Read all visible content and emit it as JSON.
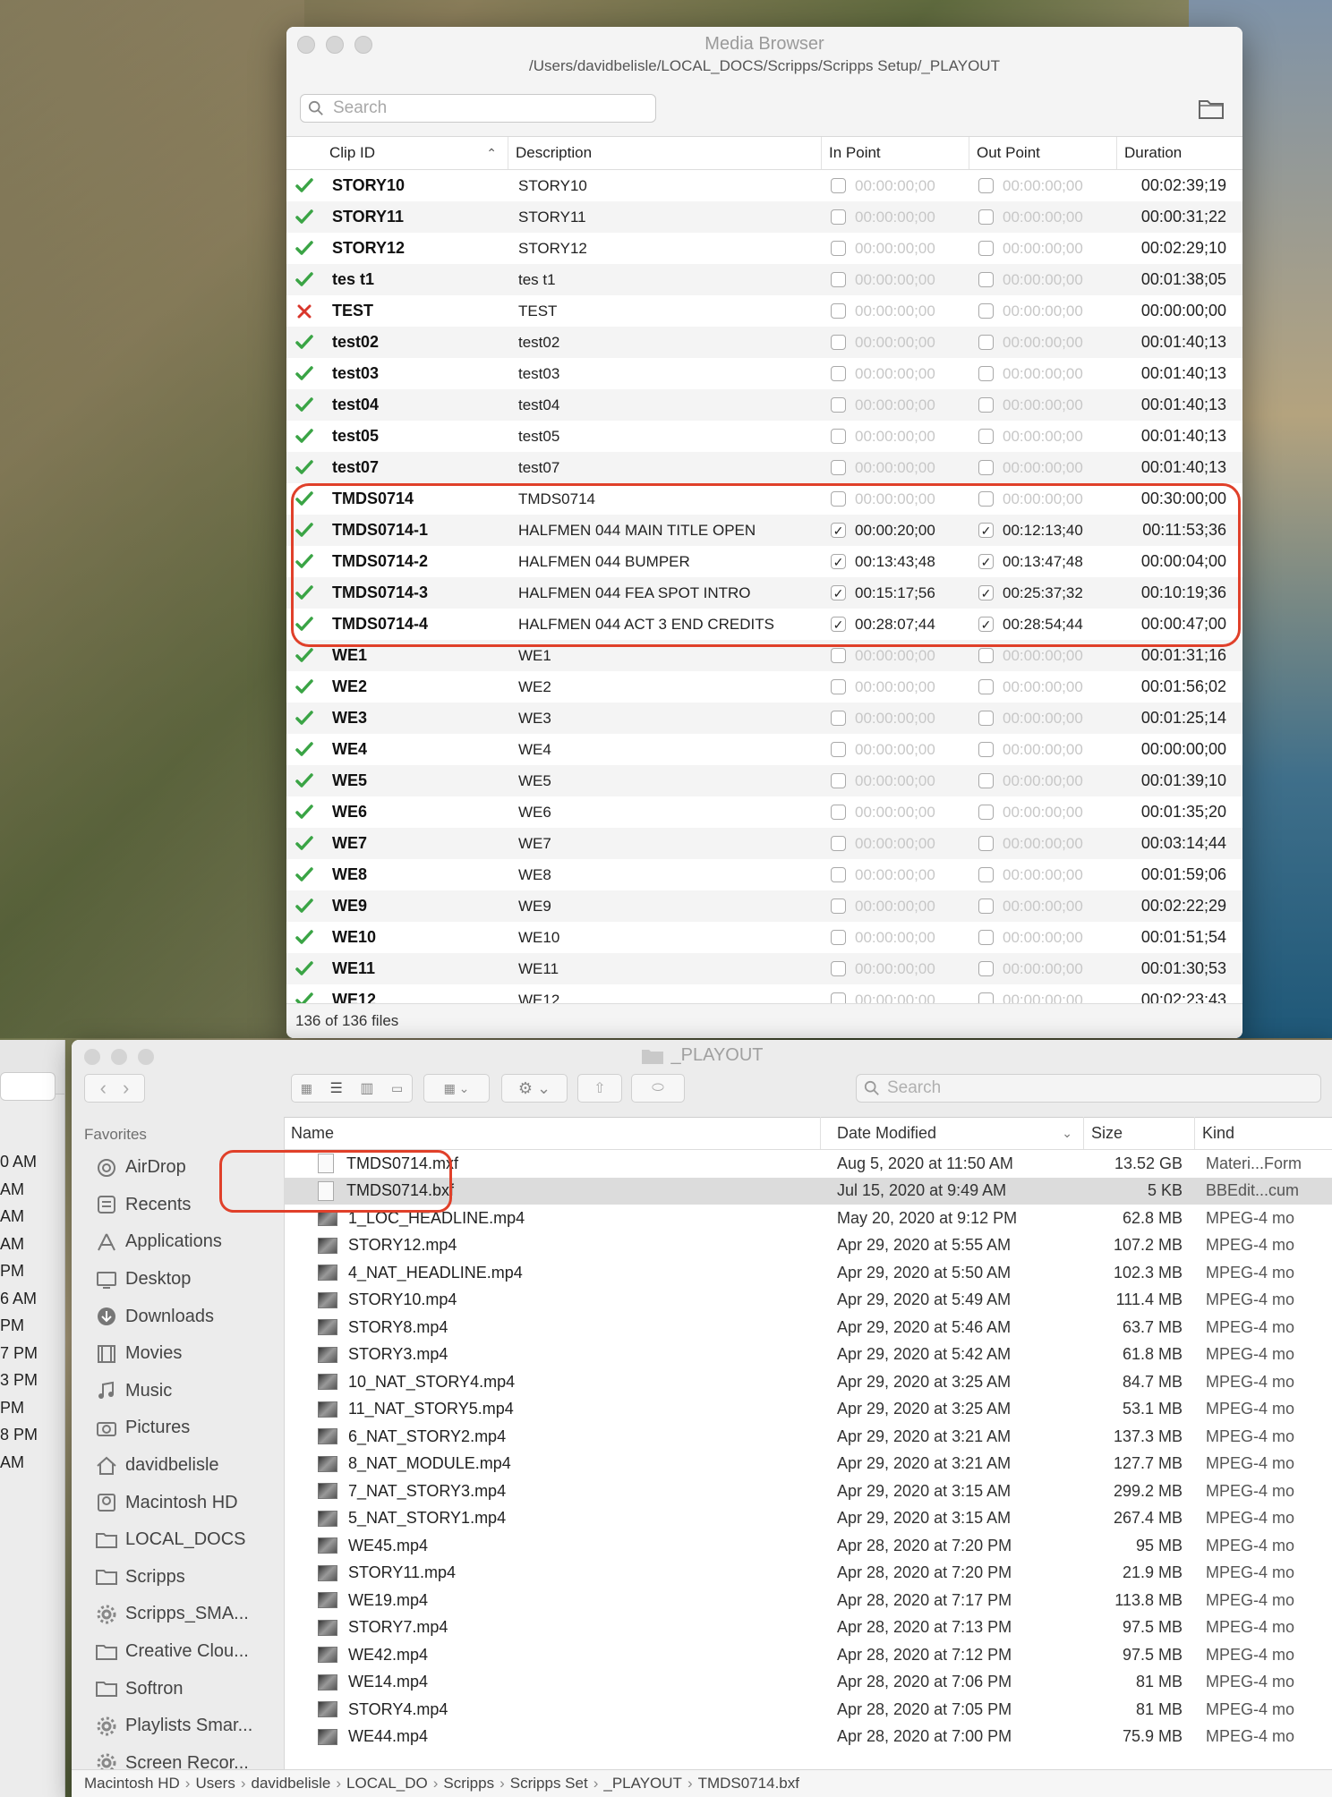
{
  "media_browser": {
    "title": "Media Browser",
    "path": "/Users/davidbelisle/LOCAL_DOCS/Scripps/Scripps Setup/_PLAYOUT",
    "search_placeholder": "Search",
    "columns": {
      "clip_id": "Clip ID",
      "description": "Description",
      "in_point": "In Point",
      "out_point": "Out Point",
      "duration": "Duration"
    },
    "rows": [
      {
        "status": "ok",
        "clip": "STORY10",
        "desc": "STORY10",
        "in_checked": false,
        "in": "00:00:00;00",
        "out_checked": false,
        "out": "00:00:00;00",
        "dur": "00:02:39;19"
      },
      {
        "status": "ok",
        "clip": "STORY11",
        "desc": "STORY11",
        "in_checked": false,
        "in": "00:00:00;00",
        "out_checked": false,
        "out": "00:00:00;00",
        "dur": "00:00:31;22"
      },
      {
        "status": "ok",
        "clip": "STORY12",
        "desc": "STORY12",
        "in_checked": false,
        "in": "00:00:00;00",
        "out_checked": false,
        "out": "00:00:00;00",
        "dur": "00:02:29;10"
      },
      {
        "status": "ok",
        "clip": "tes t1",
        "desc": "tes t1",
        "in_checked": false,
        "in": "00:00:00;00",
        "out_checked": false,
        "out": "00:00:00;00",
        "dur": "00:01:38;05"
      },
      {
        "status": "error",
        "clip": "TEST",
        "desc": "TEST",
        "in_checked": false,
        "in": "00:00:00;00",
        "out_checked": false,
        "out": "00:00:00;00",
        "dur": "00:00:00;00"
      },
      {
        "status": "ok",
        "clip": "test02",
        "desc": "test02",
        "in_checked": false,
        "in": "00:00:00;00",
        "out_checked": false,
        "out": "00:00:00;00",
        "dur": "00:01:40;13"
      },
      {
        "status": "ok",
        "clip": "test03",
        "desc": "test03",
        "in_checked": false,
        "in": "00:00:00;00",
        "out_checked": false,
        "out": "00:00:00;00",
        "dur": "00:01:40;13"
      },
      {
        "status": "ok",
        "clip": "test04",
        "desc": "test04",
        "in_checked": false,
        "in": "00:00:00;00",
        "out_checked": false,
        "out": "00:00:00;00",
        "dur": "00:01:40;13"
      },
      {
        "status": "ok",
        "clip": "test05",
        "desc": "test05",
        "in_checked": false,
        "in": "00:00:00;00",
        "out_checked": false,
        "out": "00:00:00;00",
        "dur": "00:01:40;13"
      },
      {
        "status": "ok",
        "clip": "test07",
        "desc": "test07",
        "in_checked": false,
        "in": "00:00:00;00",
        "out_checked": false,
        "out": "00:00:00;00",
        "dur": "00:01:40;13"
      },
      {
        "status": "ok",
        "clip": "TMDS0714",
        "desc": "TMDS0714",
        "in_checked": false,
        "in": "00:00:00;00",
        "out_checked": false,
        "out": "00:00:00;00",
        "dur": "00:30:00;00"
      },
      {
        "status": "ok",
        "clip": "TMDS0714-1",
        "desc": "HALFMEN 044 MAIN TITLE OPEN",
        "in_checked": true,
        "in": "00:00:20;00",
        "out_checked": true,
        "out": "00:12:13;40",
        "dur": "00:11:53;36"
      },
      {
        "status": "ok",
        "clip": "TMDS0714-2",
        "desc": "HALFMEN 044 BUMPER",
        "in_checked": true,
        "in": "00:13:43;48",
        "out_checked": true,
        "out": "00:13:47;48",
        "dur": "00:00:04;00"
      },
      {
        "status": "ok",
        "clip": "TMDS0714-3",
        "desc": "HALFMEN 044 FEA SPOT INTRO",
        "in_checked": true,
        "in": "00:15:17;56",
        "out_checked": true,
        "out": "00:25:37;32",
        "dur": "00:10:19;36"
      },
      {
        "status": "ok",
        "clip": "TMDS0714-4",
        "desc": "HALFMEN 044 ACT 3 END CREDITS",
        "in_checked": true,
        "in": "00:28:07;44",
        "out_checked": true,
        "out": "00:28:54;44",
        "dur": "00:00:47;00"
      },
      {
        "status": "ok",
        "clip": "WE1",
        "desc": "WE1",
        "in_checked": false,
        "in": "00:00:00;00",
        "out_checked": false,
        "out": "00:00:00;00",
        "dur": "00:01:31;16"
      },
      {
        "status": "ok",
        "clip": "WE2",
        "desc": "WE2",
        "in_checked": false,
        "in": "00:00:00;00",
        "out_checked": false,
        "out": "00:00:00;00",
        "dur": "00:01:56;02"
      },
      {
        "status": "ok",
        "clip": "WE3",
        "desc": "WE3",
        "in_checked": false,
        "in": "00:00:00;00",
        "out_checked": false,
        "out": "00:00:00;00",
        "dur": "00:01:25;14"
      },
      {
        "status": "ok",
        "clip": "WE4",
        "desc": "WE4",
        "in_checked": false,
        "in": "00:00:00;00",
        "out_checked": false,
        "out": "00:00:00;00",
        "dur": "00:00:00;00"
      },
      {
        "status": "ok",
        "clip": "WE5",
        "desc": "WE5",
        "in_checked": false,
        "in": "00:00:00;00",
        "out_checked": false,
        "out": "00:00:00;00",
        "dur": "00:01:39;10"
      },
      {
        "status": "ok",
        "clip": "WE6",
        "desc": "WE6",
        "in_checked": false,
        "in": "00:00:00;00",
        "out_checked": false,
        "out": "00:00:00;00",
        "dur": "00:01:35;20"
      },
      {
        "status": "ok",
        "clip": "WE7",
        "desc": "WE7",
        "in_checked": false,
        "in": "00:00:00;00",
        "out_checked": false,
        "out": "00:00:00;00",
        "dur": "00:03:14;44"
      },
      {
        "status": "ok",
        "clip": "WE8",
        "desc": "WE8",
        "in_checked": false,
        "in": "00:00:00;00",
        "out_checked": false,
        "out": "00:00:00;00",
        "dur": "00:01:59;06"
      },
      {
        "status": "ok",
        "clip": "WE9",
        "desc": "WE9",
        "in_checked": false,
        "in": "00:00:00;00",
        "out_checked": false,
        "out": "00:00:00;00",
        "dur": "00:02:22;29"
      },
      {
        "status": "ok",
        "clip": "WE10",
        "desc": "WE10",
        "in_checked": false,
        "in": "00:00:00;00",
        "out_checked": false,
        "out": "00:00:00;00",
        "dur": "00:01:51;54"
      },
      {
        "status": "ok",
        "clip": "WE11",
        "desc": "WE11",
        "in_checked": false,
        "in": "00:00:00;00",
        "out_checked": false,
        "out": "00:00:00;00",
        "dur": "00:01:30;53"
      },
      {
        "status": "ok",
        "clip": "WE12",
        "desc": "WE12",
        "in_checked": false,
        "in": "00:00:00;00",
        "out_checked": false,
        "out": "00:00:00;00",
        "dur": "00:02:23;43"
      }
    ],
    "footer": "136 of 136 files"
  },
  "left_window_times": [
    "0 AM",
    " AM",
    " AM",
    " AM",
    "PM",
    "6 AM",
    " PM",
    "7 PM",
    "3 PM",
    " PM",
    "8 PM",
    "AM"
  ],
  "finder": {
    "title": "_PLAYOUT",
    "search_placeholder": "Search",
    "favorites_label": "Favorites",
    "sidebar": [
      {
        "label": "AirDrop",
        "icon": "airdrop-icon"
      },
      {
        "label": "Recents",
        "icon": "recents-icon"
      },
      {
        "label": "Applications",
        "icon": "applications-icon"
      },
      {
        "label": "Desktop",
        "icon": "desktop-icon"
      },
      {
        "label": "Downloads",
        "icon": "downloads-icon"
      },
      {
        "label": "Movies",
        "icon": "movies-icon"
      },
      {
        "label": "Music",
        "icon": "music-icon"
      },
      {
        "label": "Pictures",
        "icon": "pictures-icon"
      },
      {
        "label": "davidbelisle",
        "icon": "home-icon"
      },
      {
        "label": "Macintosh HD",
        "icon": "disk-icon"
      },
      {
        "label": "LOCAL_DOCS",
        "icon": "folder-icon"
      },
      {
        "label": "Scripps",
        "icon": "folder-icon"
      },
      {
        "label": "Scripps_SMA...",
        "icon": "gear-icon"
      },
      {
        "label": "Creative Clou...",
        "icon": "folder-icon"
      },
      {
        "label": "Softron",
        "icon": "folder-icon"
      },
      {
        "label": "Playlists Smar...",
        "icon": "gear-icon"
      },
      {
        "label": "Screen Recor...",
        "icon": "gear-icon"
      }
    ],
    "columns": {
      "name": "Name",
      "date": "Date Modified",
      "size": "Size",
      "kind": "Kind"
    },
    "files": [
      {
        "name": "TMDS0714.mxf",
        "date": "Aug 5, 2020 at 11:50 AM",
        "size": "13.52 GB",
        "kind": "Materi...Form",
        "type": "doc",
        "selected": false
      },
      {
        "name": "TMDS0714.bxf",
        "date": "Jul 15, 2020 at 9:49 AM",
        "size": "5 KB",
        "kind": "BBEdit...cum",
        "type": "doc",
        "selected": true
      },
      {
        "name": "1_LOC_HEADLINE.mp4",
        "date": "May 20, 2020 at 9:12 PM",
        "size": "62.8 MB",
        "kind": "MPEG-4 mo",
        "type": "video",
        "selected": false
      },
      {
        "name": "STORY12.mp4",
        "date": "Apr 29, 2020 at 5:55 AM",
        "size": "107.2 MB",
        "kind": "MPEG-4 mo",
        "type": "video",
        "selected": false
      },
      {
        "name": "4_NAT_HEADLINE.mp4",
        "date": "Apr 29, 2020 at 5:50 AM",
        "size": "102.3 MB",
        "kind": "MPEG-4 mo",
        "type": "video",
        "selected": false
      },
      {
        "name": "STORY10.mp4",
        "date": "Apr 29, 2020 at 5:49 AM",
        "size": "111.4 MB",
        "kind": "MPEG-4 mo",
        "type": "video",
        "selected": false
      },
      {
        "name": "STORY8.mp4",
        "date": "Apr 29, 2020 at 5:46 AM",
        "size": "63.7 MB",
        "kind": "MPEG-4 mo",
        "type": "video",
        "selected": false
      },
      {
        "name": "STORY3.mp4",
        "date": "Apr 29, 2020 at 5:42 AM",
        "size": "61.8 MB",
        "kind": "MPEG-4 mo",
        "type": "video",
        "selected": false
      },
      {
        "name": "10_NAT_STORY4.mp4",
        "date": "Apr 29, 2020 at 3:25 AM",
        "size": "84.7 MB",
        "kind": "MPEG-4 mo",
        "type": "video",
        "selected": false
      },
      {
        "name": "11_NAT_STORY5.mp4",
        "date": "Apr 29, 2020 at 3:25 AM",
        "size": "53.1 MB",
        "kind": "MPEG-4 mo",
        "type": "video",
        "selected": false
      },
      {
        "name": "6_NAT_STORY2.mp4",
        "date": "Apr 29, 2020 at 3:21 AM",
        "size": "137.3 MB",
        "kind": "MPEG-4 mo",
        "type": "video",
        "selected": false
      },
      {
        "name": "8_NAT_MODULE.mp4",
        "date": "Apr 29, 2020 at 3:21 AM",
        "size": "127.7 MB",
        "kind": "MPEG-4 mo",
        "type": "video",
        "selected": false
      },
      {
        "name": "7_NAT_STORY3.mp4",
        "date": "Apr 29, 2020 at 3:15 AM",
        "size": "299.2 MB",
        "kind": "MPEG-4 mo",
        "type": "video",
        "selected": false
      },
      {
        "name": "5_NAT_STORY1.mp4",
        "date": "Apr 29, 2020 at 3:15 AM",
        "size": "267.4 MB",
        "kind": "MPEG-4 mo",
        "type": "video",
        "selected": false
      },
      {
        "name": "WE45.mp4",
        "date": "Apr 28, 2020 at 7:20 PM",
        "size": "95 MB",
        "kind": "MPEG-4 mo",
        "type": "video",
        "selected": false
      },
      {
        "name": "STORY11.mp4",
        "date": "Apr 28, 2020 at 7:20 PM",
        "size": "21.9 MB",
        "kind": "MPEG-4 mo",
        "type": "video",
        "selected": false
      },
      {
        "name": "WE19.mp4",
        "date": "Apr 28, 2020 at 7:17 PM",
        "size": "113.8 MB",
        "kind": "MPEG-4 mo",
        "type": "video",
        "selected": false
      },
      {
        "name": "STORY7.mp4",
        "date": "Apr 28, 2020 at 7:13 PM",
        "size": "97.5 MB",
        "kind": "MPEG-4 mo",
        "type": "video",
        "selected": false
      },
      {
        "name": "WE42.mp4",
        "date": "Apr 28, 2020 at 7:12 PM",
        "size": "97.5 MB",
        "kind": "MPEG-4 mo",
        "type": "video",
        "selected": false
      },
      {
        "name": "WE14.mp4",
        "date": "Apr 28, 2020 at 7:06 PM",
        "size": "81 MB",
        "kind": "MPEG-4 mo",
        "type": "video",
        "selected": false
      },
      {
        "name": "STORY4.mp4",
        "date": "Apr 28, 2020 at 7:05 PM",
        "size": "81 MB",
        "kind": "MPEG-4 mo",
        "type": "video",
        "selected": false
      },
      {
        "name": "WE44.mp4",
        "date": "Apr 28, 2020 at 7:00 PM",
        "size": "75.9 MB",
        "kind": "MPEG-4 mo",
        "type": "video",
        "selected": false
      }
    ],
    "pathbar": [
      "Macintosh HD",
      "Users",
      "davidbelisle",
      "LOCAL_DO",
      "Scripps",
      "Scripps Set",
      "_PLAYOUT",
      "TMDS0714.bxf"
    ]
  },
  "colors": {
    "check_green": "#3aa445",
    "error_red": "#d9362b",
    "highlight": "#e0402a"
  }
}
